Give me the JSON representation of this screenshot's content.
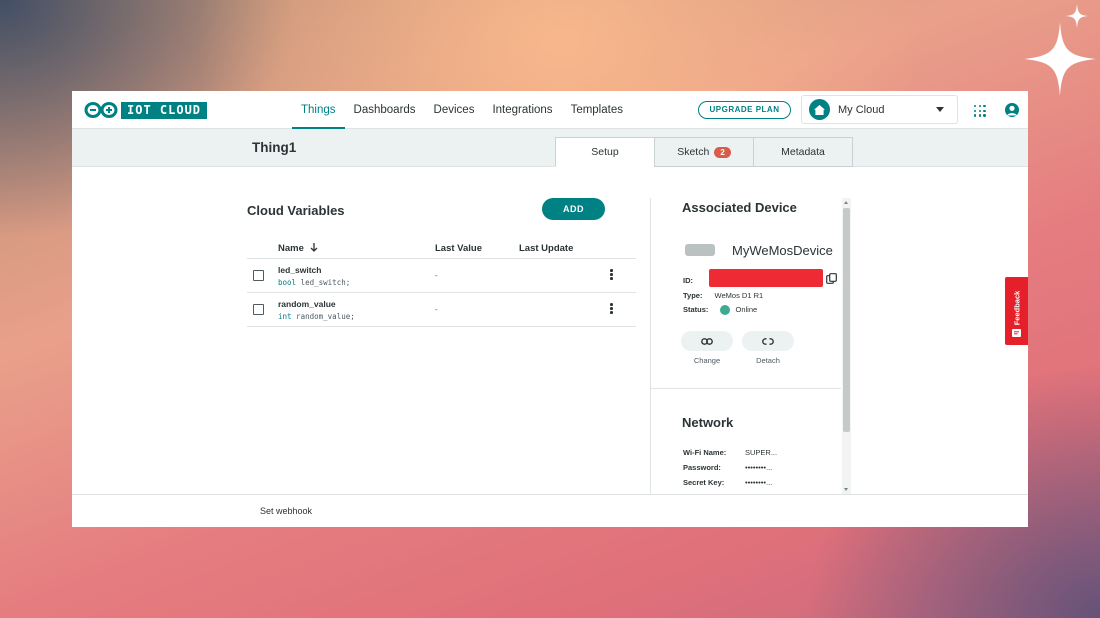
{
  "nav": {
    "logo_text": "IOT CLOUD",
    "links": [
      "Things",
      "Dashboards",
      "Devices",
      "Integrations",
      "Templates"
    ],
    "active_link": "Things",
    "upgrade_label": "UPGRADE PLAN",
    "cloud_select_value": "My Cloud"
  },
  "thing": {
    "title": "Thing1",
    "tabs": [
      {
        "label": "Setup"
      },
      {
        "label": "Sketch",
        "badge": "2"
      },
      {
        "label": "Metadata"
      }
    ],
    "active_tab": "Setup"
  },
  "variables": {
    "title": "Cloud Variables",
    "add_label": "ADD",
    "columns": {
      "name": "Name",
      "last_value": "Last Value",
      "last_update": "Last Update"
    },
    "rows": [
      {
        "name": "led_switch",
        "type": "bool",
        "decl": " led_switch;",
        "last_value": "-"
      },
      {
        "name": "random_value",
        "type": "int",
        "decl": " random_value;",
        "last_value": "-"
      }
    ]
  },
  "device": {
    "title": "Associated Device",
    "name": "MyWeMosDevice",
    "id_label": "ID:",
    "type_label": "Type:",
    "type_value": "WeMos D1 R1",
    "status_label": "Status:",
    "status_value": "Online",
    "change_label": "Change",
    "detach_label": "Detach"
  },
  "network": {
    "title": "Network",
    "wifi_label": "Wi-Fi Name:",
    "wifi_value": "SUPER...",
    "password_label": "Password:",
    "password_value": "••••••••...",
    "secret_label": "Secret Key:",
    "secret_value": "••••••••..."
  },
  "footer": {
    "webhook_label": "Set webhook"
  },
  "feedback_label": "Feedback",
  "colors": {
    "accent": "#008184",
    "badge": "#da5b4a",
    "online": "#3dab90",
    "feedback": "#e5202a"
  }
}
